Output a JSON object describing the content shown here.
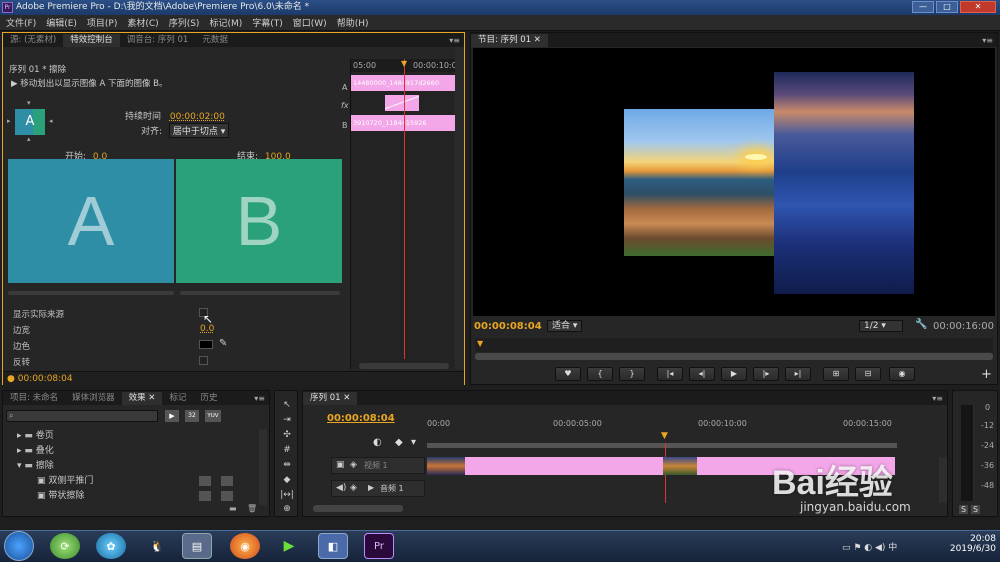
{
  "window": {
    "title": "Adobe Premiere Pro - D:\\我的文档\\Adobe\\Premiere Pro\\6.0\\未命名 *",
    "icon_label": "Pr",
    "minimize": "—",
    "maximize": "□",
    "close": "✕"
  },
  "menu": [
    "文件(F)",
    "编辑(E)",
    "项目(P)",
    "素材(C)",
    "序列(S)",
    "标记(M)",
    "字幕(T)",
    "窗口(W)",
    "帮助(H)"
  ],
  "effect_controls": {
    "tabs": [
      "源: (无素材)",
      "特效控制台",
      "调音台: 序列 01",
      "元数据"
    ],
    "active_tab": 1,
    "sequence_label": "序列 01 * 擦除",
    "description": "移动划出以显示图像 A 下面的图像 B。",
    "duration_label": "持续时间",
    "duration_value": "00:00:02:00",
    "align_label": "对齐:",
    "align_value": "居中于切点",
    "preview_letter": "A",
    "start_label": "开始:",
    "start_value": "0.0",
    "end_label": "结束:",
    "end_value": "100.0",
    "letter_a": "A",
    "letter_b": "B",
    "show_source_label": "显示实际来源",
    "border_width_label": "边宽",
    "border_width_value": "0.0",
    "border_color_label": "边色",
    "reverse_label": "反转",
    "timecode": "00:00:08:04",
    "mini_timeline": {
      "start": "05:00",
      "end": "00:00:10:0",
      "track_a": "A",
      "track_b": "B",
      "fx": "fx",
      "clip_a_text": "14480000_1484917d2660",
      "clip_b_text": "3910720_1184415926"
    }
  },
  "program_monitor": {
    "tab": "节目: 序列 01",
    "timecode": "00:00:08:04",
    "fit_label": "适合",
    "scale_label": "1/2",
    "duration": "00:00:16:00",
    "controls": [
      "♥",
      "{",
      "}",
      "|◂",
      "◂|",
      "▶",
      "|▸",
      "▸|",
      "⊞",
      "⊟",
      "◉"
    ]
  },
  "project_panel": {
    "tabs": [
      "项目: 未命名",
      "媒体浏览器",
      "效果",
      "标记",
      "历史"
    ],
    "active_tab": 2,
    "search_placeholder": "",
    "btn_labels": [
      "▶",
      "32",
      "YUV"
    ],
    "items": [
      {
        "label": "卷页",
        "level": 1,
        "type": "folder"
      },
      {
        "label": "叠化",
        "level": 1,
        "type": "folder"
      },
      {
        "label": "擦除",
        "level": 1,
        "type": "folder-open"
      },
      {
        "label": "双侧平推门",
        "level": 2,
        "type": "effect"
      },
      {
        "label": "带状擦除",
        "level": 2,
        "type": "effect"
      }
    ]
  },
  "timeline": {
    "tab": "序列 01",
    "timecode": "00:00:08:04",
    "ruler": [
      "00:00",
      "00:00:05:00",
      "00:00:10:00",
      "00:00:15:00"
    ],
    "video_track": "视频 1",
    "audio_track": "音频 1"
  },
  "audio_meter": {
    "labels": [
      "0",
      "-12",
      "-24",
      "-36",
      "-48"
    ],
    "solo": "S"
  },
  "taskbar": {
    "time": "20:08",
    "date": "2019/6/30",
    "pr_label": "Pr"
  },
  "watermark": {
    "brand": "Bai经验",
    "url": "jingyan.baidu.com"
  },
  "colors": {
    "accent": "#e8a623",
    "clip": "#f3a6e8",
    "playhead": "#d33"
  }
}
